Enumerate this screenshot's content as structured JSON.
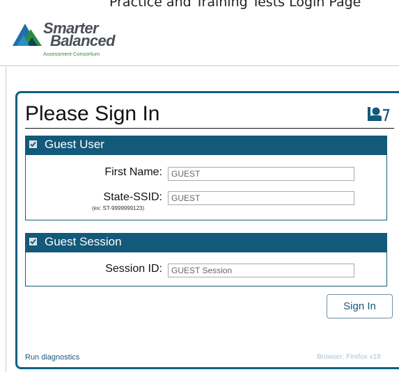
{
  "window": {
    "caption": "Practice and Training Tests Login Page"
  },
  "logo": {
    "line1": "Smarter",
    "line2": "Balanced",
    "line3": "Assessment Consortium"
  },
  "page": {
    "title": "Please Sign In",
    "help_icon": "user-help-icon"
  },
  "guest_user": {
    "header": "Guest User",
    "checked": true,
    "first_name": {
      "label": "First Name:",
      "value": "GUEST"
    },
    "ssid": {
      "label": "State-SSID:",
      "hint": "(ex: ST-9999999123)",
      "value": "GUEST"
    }
  },
  "guest_session": {
    "header": "Guest Session",
    "checked": true,
    "session_id": {
      "label": "Session ID:",
      "value": "GUEST Session"
    }
  },
  "actions": {
    "sign_in": "Sign In"
  },
  "footer": {
    "diagnostics": "Run diagnostics",
    "browser": "Browser: Firefox v19"
  },
  "colors": {
    "primary": "#13597a",
    "border": "#0e5f86",
    "logo_green": "#2e8a3e",
    "logo_blue": "#1f6fa8"
  }
}
